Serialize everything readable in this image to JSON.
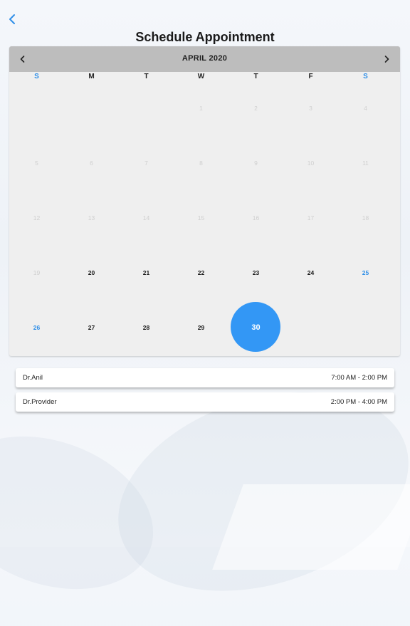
{
  "header": {
    "title": "Schedule Appointment"
  },
  "calendar": {
    "month_label": "APRIL 2020",
    "weekdays": [
      {
        "label": "S",
        "weekend": true
      },
      {
        "label": "M",
        "weekend": false
      },
      {
        "label": "T",
        "weekend": false
      },
      {
        "label": "W",
        "weekend": false
      },
      {
        "label": "T",
        "weekend": false
      },
      {
        "label": "F",
        "weekend": false
      },
      {
        "label": "S",
        "weekend": true
      }
    ],
    "weeks": [
      [
        "",
        "",
        "",
        "1",
        "2",
        "3",
        "4"
      ],
      [
        "5",
        "6",
        "7",
        "8",
        "9",
        "10",
        "11"
      ],
      [
        "12",
        "13",
        "14",
        "15",
        "16",
        "17",
        "18"
      ],
      [
        "19",
        "20",
        "21",
        "22",
        "23",
        "24",
        "25"
      ],
      [
        "26",
        "27",
        "28",
        "29",
        "30",
        "",
        ""
      ]
    ],
    "first_available_day": 20,
    "selected_day": "30",
    "colors": {
      "accent": "#3397f5",
      "weekend": "#2f8fe8",
      "header_bg": "#bdbdbd",
      "body_bg": "#efefef",
      "disabled_text": "#cfcfcf"
    }
  },
  "slots": [
    {
      "provider": "Dr.Anil",
      "time": "7:00 AM - 2:00 PM"
    },
    {
      "provider": "Dr.Provider",
      "time": "2:00 PM - 4:00 PM"
    }
  ],
  "icons": {
    "back": "chevron-left-icon",
    "prev_month": "chevron-left-icon",
    "next_month": "chevron-right-icon"
  }
}
